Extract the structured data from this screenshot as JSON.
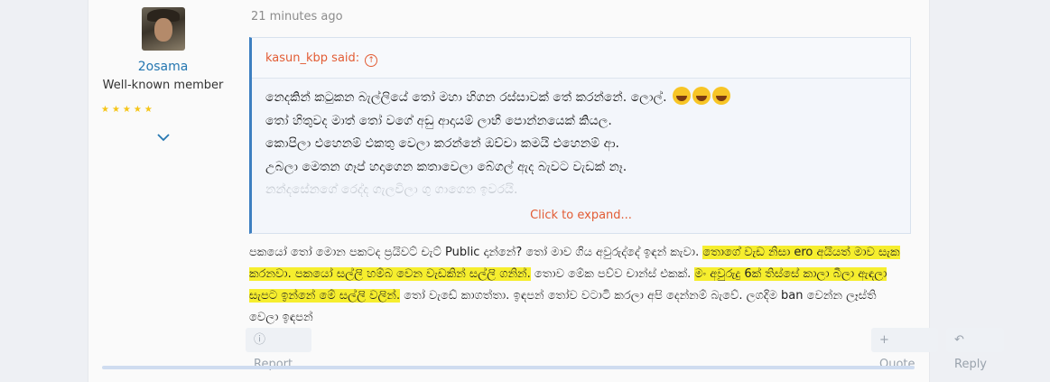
{
  "user": {
    "name": "2osama",
    "title": "Well-known member",
    "stars": "★★★★★"
  },
  "post": {
    "time": "21 minutes ago",
    "quote": {
      "author_said": "kasun_kbp said:",
      "lines": [
        "නෙදකින් කටුකන බැල්ලියේ තෝ මහා හිගන රස්සාවක් තේ කරන්නේ. ලොල්.",
        "තෝ හිතුවද මාත් තෝ වගේ අඩු ආදායම් ලාභී පොන්නයෙක් කියල.",
        "කොපිලා එහෙනම් එකතු වෙලා කරන්නේ ඔච්චා කමයි එහෙනම් ආ.",
        "උබලා මෙතන ගෑප් හදාගෙන කතාවෙලා බේගල් ඇද බැවට වැඩක් නෑ.",
        "නන්දසේනගේ රෙද්ද ගැලවිලා ගු ගාගෙන ඉවරයි."
      ],
      "expand_label": "Click to expand..."
    },
    "body": {
      "part1": "පකයෝ තෝ මොන පකටද ප්‍රයිවට් චැට් Public දාන්නේ? තෝ මාව ගිය අවුරුද්දේ ඉඳන් කැවා. ",
      "hl1": "තොගේ වැඩ නිසා ero අයියත් මාව සැක කරනවා. පකයෝ සල්ලි හම්බ වෙන වැඩකින් සල්ලි ගනින්.",
      "part2": " තොව මේක පව්ව චාන්ස් එකක්. ",
      "hl2": "මං අවුරුදු 6ක් තිස්සේ කාලා බීලා ඇඳලා සැපට ඉන්නේ මේ සල්ලි වලින්.",
      "part3": " තෝ වැඩේ කාගත්තා. ඉඳපන් තෝව වටාටි කරලා අපි දෙන්නම් බැවේ. ලගදිම ban වෙන්න ලෑස්ති වෙලා ඉඳපන්"
    },
    "actions": {
      "report": "Report",
      "quote": "Quote",
      "reply": "Reply"
    }
  },
  "colors": {
    "link": "#2577b1",
    "quote_accent": "#e25c34",
    "highlight": "#f6ee2e"
  }
}
